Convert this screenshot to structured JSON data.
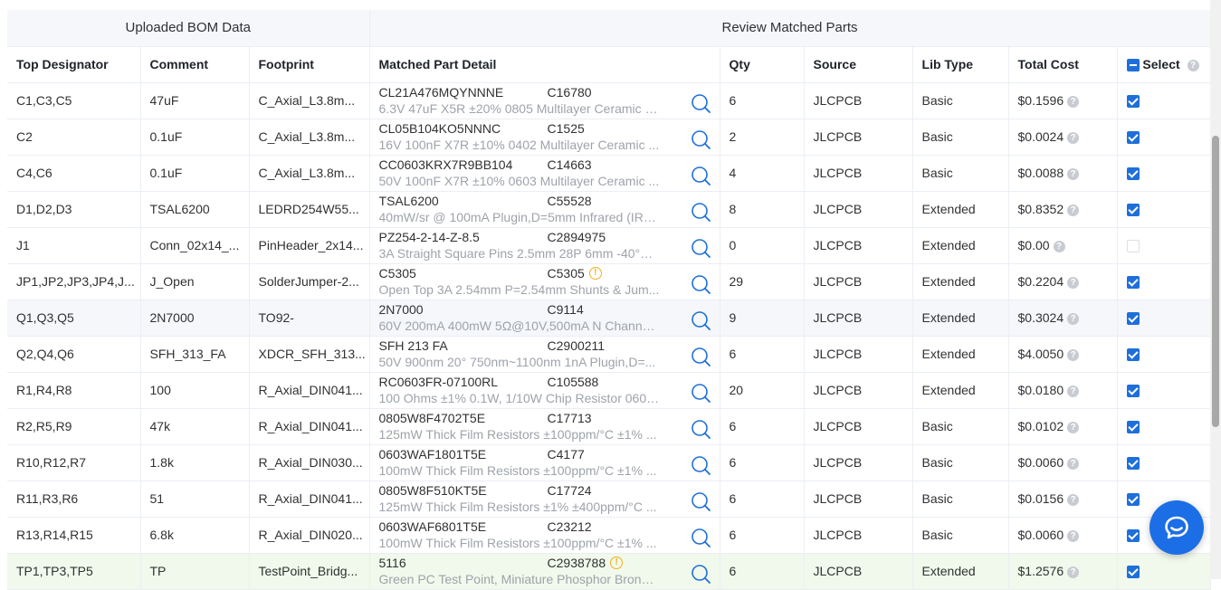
{
  "groups": {
    "left": "Uploaded BOM Data",
    "right": "Review Matched Parts"
  },
  "columns": {
    "designator": "Top Designator",
    "comment": "Comment",
    "footprint": "Footprint",
    "detail": "Matched Part Detail",
    "qty": "Qty",
    "source": "Source",
    "lib_type": "Lib Type",
    "total_cost": "Total Cost",
    "select": "Select"
  },
  "help_glyph": "?",
  "warn_glyph": "!",
  "rows": [
    {
      "designator": "C1,C3,C5",
      "comment": "47uF",
      "footprint": "C_Axial_L3.8m...",
      "mpn": "CL21A476MQYNNNE",
      "lcsc": "C16780",
      "desc": "6.3V 47uF X5R ±20% 0805 Multilayer Ceramic C...",
      "qty": "6",
      "source": "JLCPCB",
      "lib": "Basic",
      "cost": "$0.1596",
      "checked": true
    },
    {
      "designator": "C2",
      "comment": "0.1uF",
      "footprint": "C_Axial_L3.8m...",
      "mpn": "CL05B104KO5NNNC",
      "lcsc": "C1525",
      "desc": "16V 100nF X7R ±10% 0402 Multilayer Ceramic ...",
      "qty": "2",
      "source": "JLCPCB",
      "lib": "Basic",
      "cost": "$0.0024",
      "checked": true
    },
    {
      "designator": "C4,C6",
      "comment": "0.1uF",
      "footprint": "C_Axial_L3.8m...",
      "mpn": "CC0603KRX7R9BB104",
      "lcsc": "C14663",
      "desc": "50V 100nF X7R ±10% 0603 Multilayer Ceramic ...",
      "qty": "4",
      "source": "JLCPCB",
      "lib": "Basic",
      "cost": "$0.0088",
      "checked": true
    },
    {
      "designator": "D1,D2,D3",
      "comment": "TSAL6200",
      "footprint": "LEDRD254W55...",
      "mpn": "TSAL6200",
      "lcsc": "C55528",
      "desc": "40mW/sr @ 100mA Plugin,D=5mm Infrared (IR) ...",
      "qty": "8",
      "source": "JLCPCB",
      "lib": "Extended",
      "cost": "$0.8352",
      "checked": true
    },
    {
      "designator": "J1",
      "comment": "Conn_02x14_...",
      "footprint": "PinHeader_2x14...",
      "mpn": "PZ254-2-14-Z-8.5",
      "lcsc": "C2894975",
      "desc": "3A Straight Square Pins 2.5mm 28P 6mm -40°C...",
      "qty": "0",
      "source": "JLCPCB",
      "lib": "Extended",
      "cost": "$0.00",
      "checked": false
    },
    {
      "designator": "JP1,JP2,JP3,JP4,J...",
      "comment": "J_Open",
      "footprint": "SolderJumper-2...",
      "mpn": "C5305",
      "lcsc": "C5305",
      "warn": true,
      "desc": "Open Top 3A 2.54mm P=2.54mm Shunts & Jum...",
      "qty": "29",
      "source": "JLCPCB",
      "lib": "Extended",
      "cost": "$0.2204",
      "checked": true
    },
    {
      "designator": "Q1,Q3,Q5",
      "comment": "2N7000",
      "footprint": "TO92-",
      "mpn": "2N7000",
      "lcsc": "C9114",
      "desc": "60V 200mA 400mW 5Ω@10V,500mA N Channel...",
      "qty": "9",
      "source": "JLCPCB",
      "lib": "Extended",
      "cost": "$0.3024",
      "checked": true,
      "hl": true
    },
    {
      "designator": "Q2,Q4,Q6",
      "comment": "SFH_313_FA",
      "footprint": "XDCR_SFH_313...",
      "mpn": "SFH 213 FA",
      "lcsc": "C2900211",
      "desc": "50V 900nm 20° 750nm~1100nm 1nA Plugin,D=...",
      "qty": "6",
      "source": "JLCPCB",
      "lib": "Extended",
      "cost": "$4.0050",
      "checked": true
    },
    {
      "designator": "R1,R4,R8",
      "comment": "100",
      "footprint": "R_Axial_DIN041...",
      "mpn": "RC0603FR-07100RL",
      "lcsc": "C105588",
      "desc": "100 Ohms ±1% 0.1W, 1/10W Chip Resistor 0603...",
      "qty": "20",
      "source": "JLCPCB",
      "lib": "Extended",
      "cost": "$0.0180",
      "checked": true
    },
    {
      "designator": "R2,R5,R9",
      "comment": "47k",
      "footprint": "R_Axial_DIN041...",
      "mpn": "0805W8F4702T5E",
      "lcsc": "C17713",
      "desc": "125mW Thick Film Resistors ±100ppm/°C ±1% ...",
      "qty": "6",
      "source": "JLCPCB",
      "lib": "Basic",
      "cost": "$0.0102",
      "checked": true
    },
    {
      "designator": "R10,R12,R7",
      "comment": "1.8k",
      "footprint": "R_Axial_DIN030...",
      "mpn": "0603WAF1801T5E",
      "lcsc": "C4177",
      "desc": "100mW Thick Film Resistors ±100ppm/°C ±1% ...",
      "qty": "6",
      "source": "JLCPCB",
      "lib": "Basic",
      "cost": "$0.0060",
      "checked": true
    },
    {
      "designator": "R11,R3,R6",
      "comment": "51",
      "footprint": "R_Axial_DIN041...",
      "mpn": "0805W8F510KT5E",
      "lcsc": "C17724",
      "desc": "125mW Thick Film Resistors ±1% ±400ppm/°C ...",
      "qty": "6",
      "source": "JLCPCB",
      "lib": "Basic",
      "cost": "$0.0156",
      "checked": true
    },
    {
      "designator": "R13,R14,R15",
      "comment": "6.8k",
      "footprint": "R_Axial_DIN020...",
      "mpn": "0603WAF6801T5E",
      "lcsc": "C23212",
      "desc": "100mW Thick Film Resistors ±100ppm/°C ±1% ...",
      "qty": "6",
      "source": "JLCPCB",
      "lib": "Basic",
      "cost": "$0.0060",
      "checked": true
    },
    {
      "designator": "TP1,TP3,TP5",
      "comment": "TP",
      "footprint": "TestPoint_Bridg...",
      "mpn": "5116",
      "lcsc": "C2938788",
      "warn": true,
      "desc": "Green PC Test Point, Miniature Phosphor Bronze...",
      "qty": "6",
      "source": "JLCPCB",
      "lib": "Extended",
      "cost": "$1.2576",
      "checked": true,
      "sel": true
    }
  ]
}
